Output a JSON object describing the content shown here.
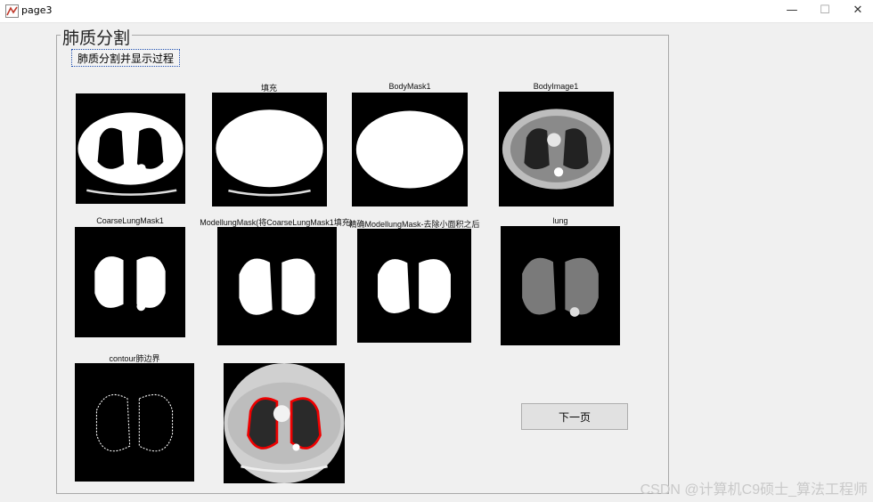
{
  "window": {
    "title": "page3",
    "minimize": "—",
    "maximize": "☐",
    "close": "✕"
  },
  "panel": {
    "title": "肺质分割"
  },
  "buttons": {
    "segment": "肺质分割并显示过程",
    "next": "下一页"
  },
  "captions": {
    "fill": "填充",
    "body_mask": "BodyMask1",
    "body_image": "BodyImage1",
    "coarse": "CoarseLungMask1",
    "modelling": "ModellungMask(将CoarseLungMask1填充)",
    "refined": "精确ModellungMask-去除小面积之后",
    "lung": "lung",
    "contour": "contour肺边界"
  },
  "watermark": "CSDN @计算机C9硕士_算法工程师",
  "icons": {
    "app": "matlab-figure-icon"
  }
}
